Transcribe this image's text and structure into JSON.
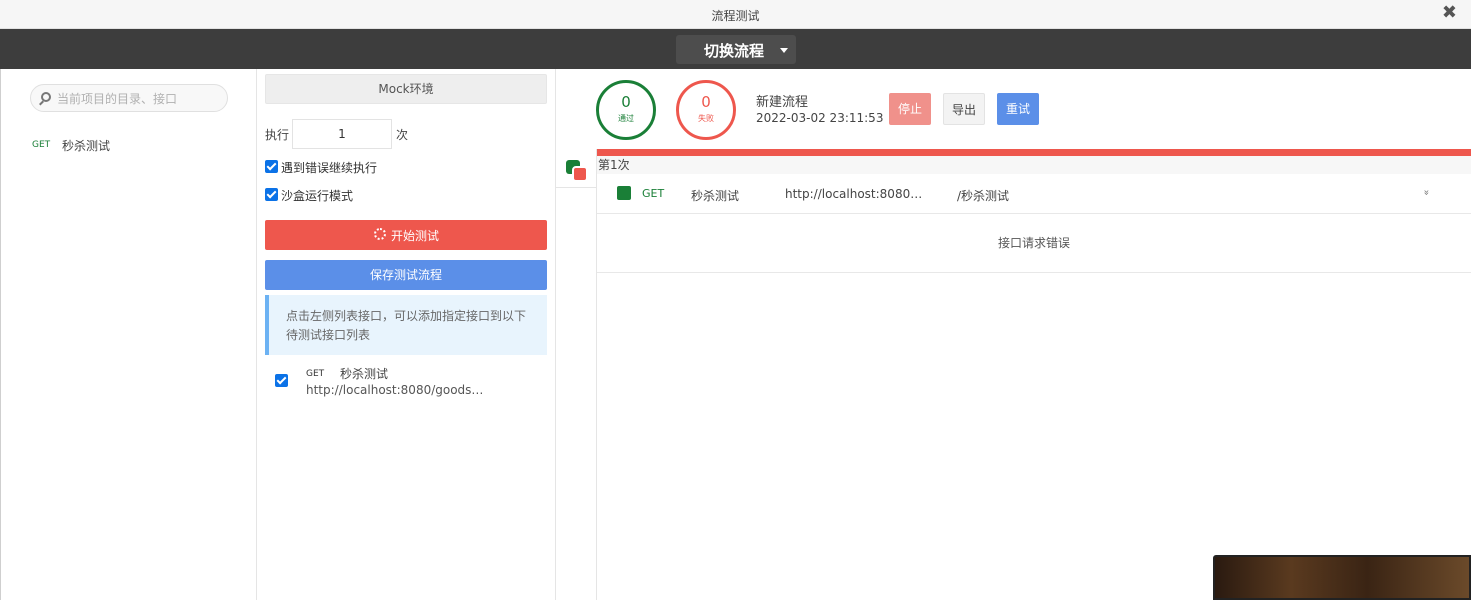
{
  "window": {
    "title": "流程测试",
    "close_symbol": "✖"
  },
  "topbar": {
    "switch_label": "切换流程"
  },
  "left": {
    "search_placeholder": "当前项目的目录、接口",
    "apis": [
      {
        "method": "GET",
        "name": "秒杀测试"
      }
    ]
  },
  "middle": {
    "mock_label": "Mock环境",
    "exec_prefix": "执行",
    "exec_count": "1",
    "exec_suffix": "次",
    "continue_on_error": "遇到错误继续执行",
    "sandbox_mode": "沙盒运行模式",
    "start_label": "开始测试",
    "save_label": "保存测试流程",
    "tip": "点击左侧列表接口，可以添加指定接口到以下待测试接口列表",
    "requests": [
      {
        "method": "GET",
        "name": "秒杀测试",
        "url": "http://localhost:8080/goods?u..."
      }
    ]
  },
  "stats": {
    "pass_count": "0",
    "pass_label": "通过",
    "fail_count": "0",
    "fail_label": "失败",
    "flow_name": "新建流程",
    "flow_time": "2022-03-02 23:11:53",
    "stop_label": "停止",
    "export_label": "导出",
    "retry_label": "重试",
    "colors": {
      "pass": "#1a7f37",
      "fail": "#ee574d",
      "primary": "#5b8fe8"
    }
  },
  "results": {
    "iteration_label": "第1次",
    "progress_percent": 100,
    "rows": [
      {
        "method": "GET",
        "name": "秒杀测试",
        "url": "http://localhost:8080/go...",
        "path": "/秒杀测试",
        "expand_symbol": "»"
      }
    ],
    "error_message": "接口请求错误"
  }
}
